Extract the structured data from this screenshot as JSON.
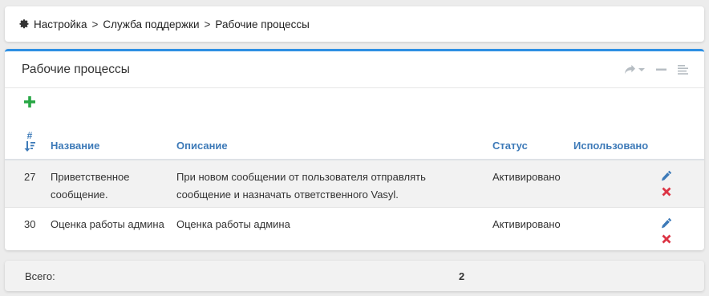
{
  "breadcrumb": {
    "items": [
      "Настройка",
      "Служба поддержки",
      "Рабочие процессы"
    ],
    "separator": ">"
  },
  "panel": {
    "title": "Рабочие процессы"
  },
  "table": {
    "columns": {
      "id": "#",
      "name": "Название",
      "description": "Описание",
      "status": "Статус",
      "used": "Использовано"
    },
    "rows": [
      {
        "id": "27",
        "name_line1": "Приветственное",
        "name_line2": "сообщение.",
        "description_line1": "При новом сообщении от пользователя отправлять",
        "description_line2": "сообщение и назначать ответственного Vasyl.",
        "status": "Активировано",
        "used": ""
      },
      {
        "id": "30",
        "name_line1": "Оценка работы админа",
        "name_line2": "",
        "description_line1": "Оценка работы админа",
        "description_line2": "",
        "status": "Активировано",
        "used": ""
      }
    ]
  },
  "footer": {
    "total_label": "Всего:",
    "total_value": "2"
  },
  "colors": {
    "accent": "#2d8fe3",
    "header_link": "#3d7ab8",
    "status_active": "#28a745",
    "add": "#28a745",
    "delete": "#dc3545"
  },
  "icons": [
    "gear-icon",
    "share-icon",
    "caret-down-icon",
    "minimize-icon",
    "align-icon",
    "plus-icon",
    "sort-desc-icon",
    "pencil-icon",
    "times-icon"
  ]
}
